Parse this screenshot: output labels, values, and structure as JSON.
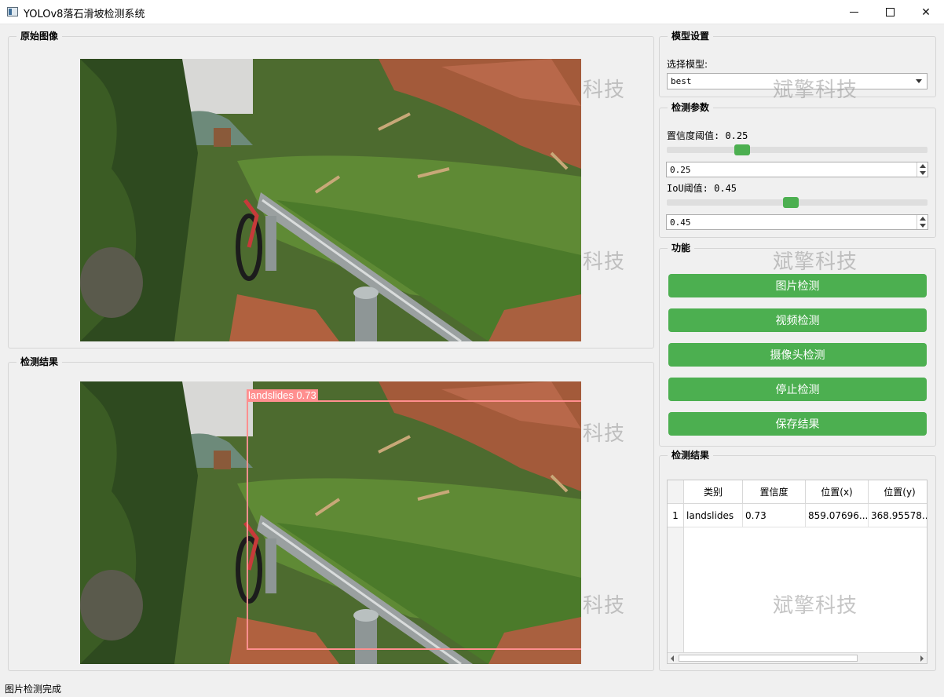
{
  "window": {
    "title": "YOLOv8落石滑坡检测系统"
  },
  "panels": {
    "original_image_title": "原始图像",
    "detection_image_title": "检测结果"
  },
  "detection_overlay": {
    "label": "landslides  0.73",
    "color": "#ff8f8f"
  },
  "model_settings": {
    "title": "模型设置",
    "select_label": "选择模型:",
    "selected_model": "best"
  },
  "detection_params": {
    "title": "检测参数",
    "confidence_label": "置信度阈值: 0.25",
    "confidence_value": "0.25",
    "confidence_fraction": 0.25,
    "iou_label": "IoU阈值: 0.45",
    "iou_value": "0.45",
    "iou_fraction": 0.45
  },
  "functions": {
    "title": "功能",
    "buttons": [
      "图片检测",
      "视频检测",
      "摄像头检测",
      "停止检测",
      "保存结果"
    ]
  },
  "results": {
    "title": "检测结果",
    "columns": [
      "类别",
      "置信度",
      "位置(x)",
      "位置(y)"
    ],
    "rows": [
      {
        "index": "1",
        "cells": [
          "landslides",
          "0.73",
          "859.07696...",
          "368.95578..."
        ]
      }
    ]
  },
  "watermark_text": "斌擎科技",
  "watermark_partial": "科技",
  "status_bar": {
    "message": "图片检测完成"
  },
  "colors": {
    "accent_green": "#4caf50",
    "bbox": "#ff8f8f"
  }
}
